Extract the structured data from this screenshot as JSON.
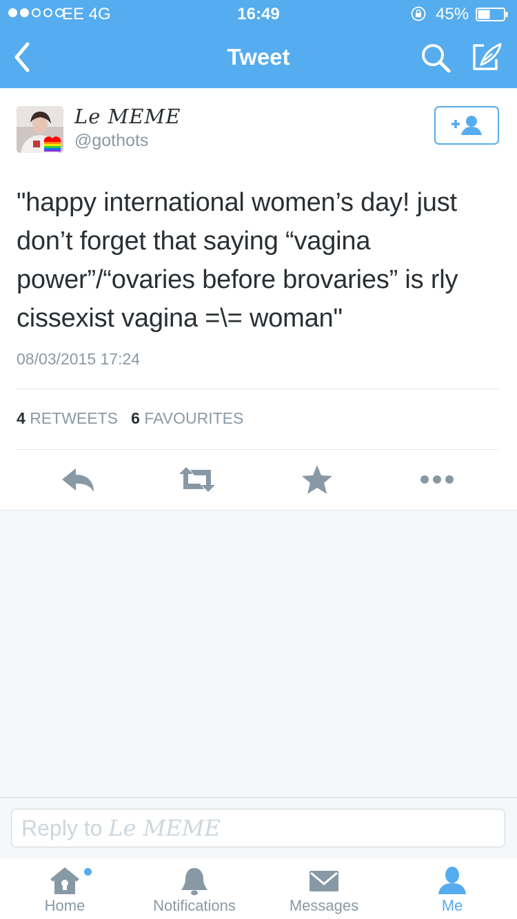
{
  "status_bar": {
    "carrier": "EE  4G",
    "time": "16:49",
    "battery": "45%"
  },
  "nav": {
    "title": "Tweet",
    "icons": [
      "back-chevron-icon",
      "search-icon",
      "compose-icon"
    ]
  },
  "tweet": {
    "author_name": "Le MEME",
    "author_handle": "@gothots",
    "text": "\"happy international women’s day! just don’t forget that saying “vagina power”/“ovaries before brovaries” is rly cissexist vagina =\\= woman\"",
    "timestamp": "08/03/2015 17:24",
    "retweets_count": "4",
    "retweets_label": "RETWEETS",
    "favourites_count": "6",
    "favourites_label": "FAVOURITES",
    "actions": [
      "reply-icon",
      "retweet-icon",
      "favourite-icon",
      "more-icon"
    ],
    "follow_icon": "add-user-icon"
  },
  "reply": {
    "prefix": "Reply to",
    "name": "Le MEME"
  },
  "tabs": [
    {
      "label": "Home",
      "icon": "home-icon",
      "active": false
    },
    {
      "label": "Notifications",
      "icon": "bell-icon",
      "active": false
    },
    {
      "label": "Messages",
      "icon": "envelope-icon",
      "active": false
    },
    {
      "label": "Me",
      "icon": "person-icon",
      "active": true
    }
  ],
  "colors": {
    "brand": "#55acee",
    "text": "#292f33",
    "muted": "#8899a6",
    "icon_gray": "#8899a6",
    "background": "#f5f8fa"
  }
}
